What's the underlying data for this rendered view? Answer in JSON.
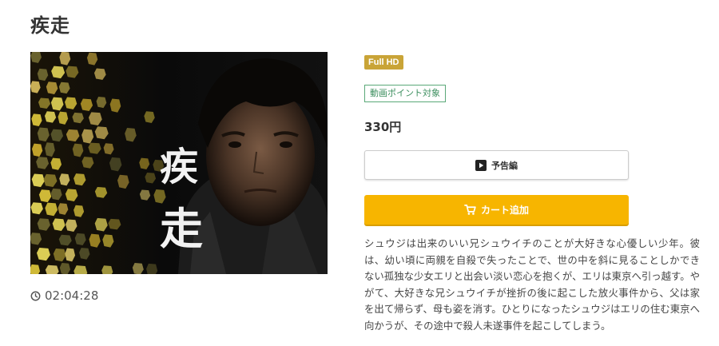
{
  "title": "疾走",
  "poster": {
    "title_text": "疾走"
  },
  "duration": "02:04:28",
  "badges": {
    "quality": "Full HD",
    "points": "動画ポイント対象"
  },
  "price": "330円",
  "buttons": {
    "trailer_label": "予告編",
    "cart_label": "カート追加"
  },
  "description": "シュウジは出来のいい兄シュウイチのことが大好きな心優しい少年。彼は、幼い頃に両親を自殺で失ったことで、世の中を斜に見ることしかできない孤独な少女エリと出会い淡い恋心を抱くが、エリは東京へ引っ越す。やがて、大好きな兄シュウイチが挫折の後に起こした放火事件から、父は家を出て帰らず、母も姿を消す。ひとりになったシュウジはエリの住む東京へ向かうが、その途中で殺人未遂事件を起こしてしまう。",
  "colors": {
    "fullhd_badge": "#c9a437",
    "points_badge": "#3d8f5f",
    "cart_button": "#f7b500"
  },
  "icons": {
    "duration": "clock-icon",
    "trailer": "play-icon",
    "cart": "cart-icon"
  }
}
